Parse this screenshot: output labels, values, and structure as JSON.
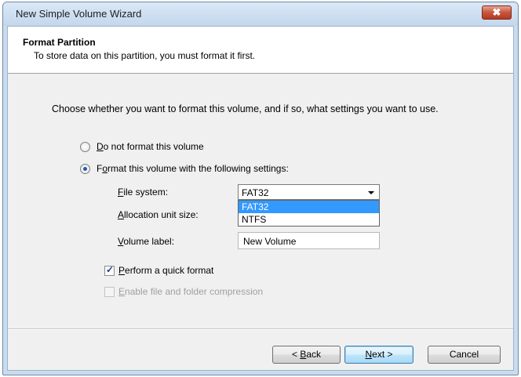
{
  "window": {
    "title": "New Simple Volume Wizard",
    "close_glyph": "✖"
  },
  "header": {
    "title": "Format Partition",
    "subtitle": "To store data on this partition, you must format it first."
  },
  "instruction": "Choose whether you want to format this volume, and if so, what settings you want to use.",
  "options": {
    "no_format": {
      "mnemonic": "D",
      "rest": "o not format this volume",
      "checked": false
    },
    "format": {
      "pre": "F",
      "mnemonic": "o",
      "rest": "rmat this volume with the following settings:",
      "checked": true
    }
  },
  "file_system": {
    "label_mnemonic": "F",
    "label_rest": "ile system:",
    "value": "FAT32",
    "dropdown_options": [
      "FAT32",
      "NTFS"
    ],
    "highlighted": "FAT32"
  },
  "allocation": {
    "label_mnemonic": "A",
    "label_rest": "llocation unit size:"
  },
  "volume_label": {
    "label_mnemonic": "V",
    "label_rest": "olume label:",
    "value": "New Volume"
  },
  "quick_format": {
    "mnemonic": "P",
    "rest": "erform a quick format",
    "checked": true
  },
  "compression": {
    "mnemonic": "E",
    "rest": "nable file and folder compression",
    "checked": false,
    "enabled": false
  },
  "buttons": {
    "back": {
      "pre": "< ",
      "mnemonic": "B",
      "rest": "ack"
    },
    "next": {
      "mnemonic": "N",
      "rest": "ext >"
    },
    "cancel": "Cancel"
  },
  "colors": {
    "selection": "#3399ff",
    "close_button": "#c8543c"
  }
}
